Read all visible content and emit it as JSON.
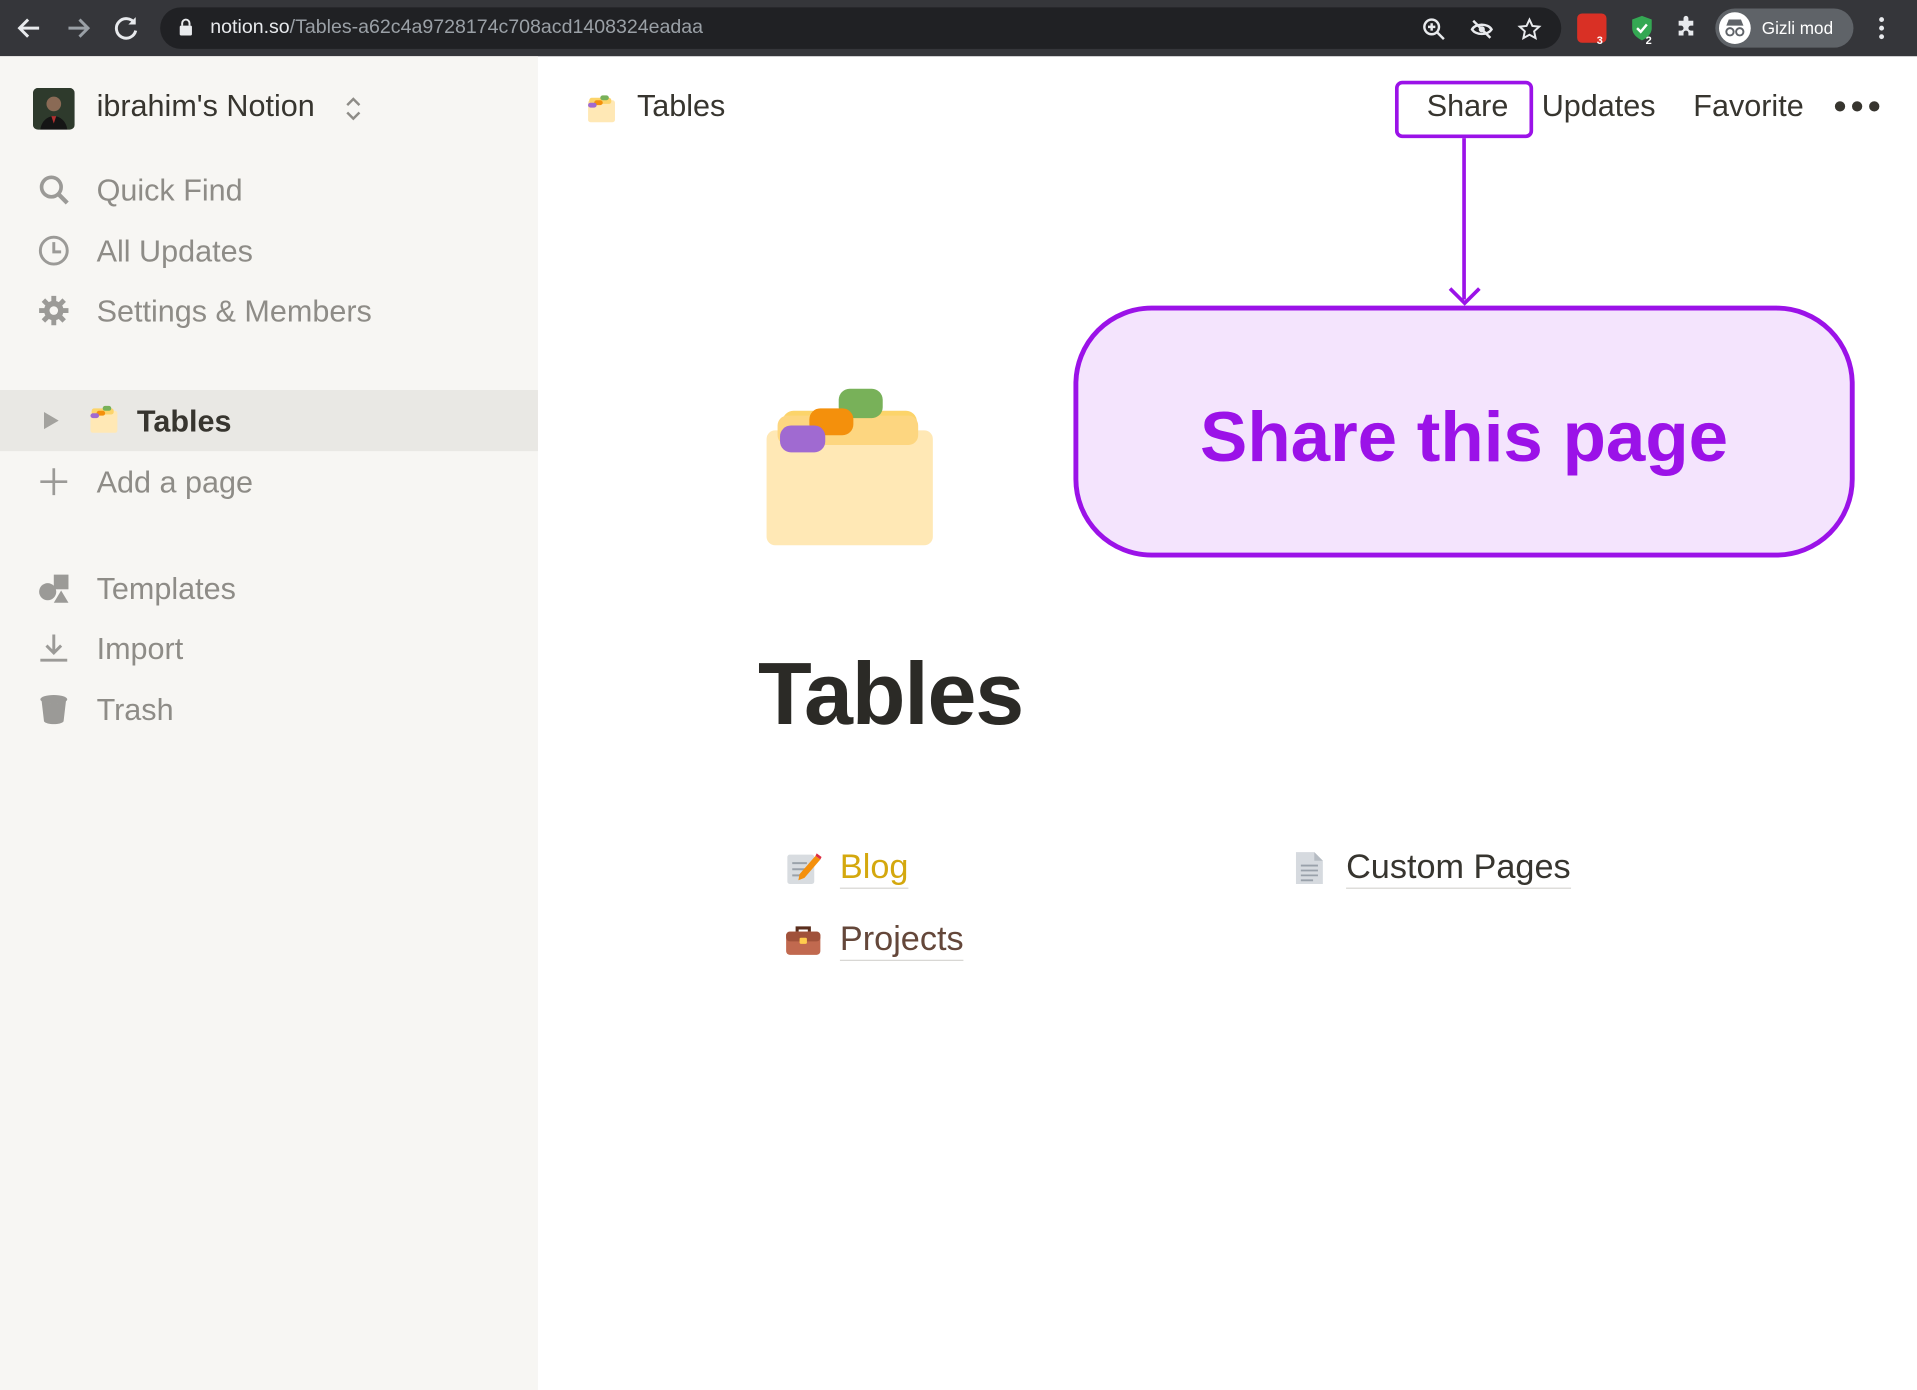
{
  "browser": {
    "url_host": "notion.so",
    "url_path": "/Tables-a62c4a9728174c708acd1408324eadaa",
    "ext1_badge": "3",
    "ext2_badge": "2",
    "incognito_label": "Gizli mod",
    "icons": [
      "back-icon",
      "forward-icon",
      "reload-icon",
      "lock-icon",
      "zoom-icon",
      "eye-off-icon",
      "star-icon",
      "puzzle-icon",
      "incognito-icon",
      "more-vert-icon"
    ]
  },
  "sidebar": {
    "workspace_name": "ibrahim's Notion",
    "items": [
      {
        "label": "Quick Find",
        "icon": "search-icon"
      },
      {
        "label": "All Updates",
        "icon": "clock-icon"
      },
      {
        "label": "Settings & Members",
        "icon": "gear-icon"
      }
    ],
    "pages": [
      {
        "label": "Tables",
        "icon": "card-index-icon",
        "active": true
      }
    ],
    "add_page_label": "Add a page",
    "bottom_items": [
      {
        "label": "Templates",
        "icon": "shapes-icon"
      },
      {
        "label": "Import",
        "icon": "download-icon"
      },
      {
        "label": "Trash",
        "icon": "trash-icon"
      }
    ]
  },
  "topbar": {
    "breadcrumb": "Tables",
    "share_label": "Share",
    "updates_label": "Updates",
    "favorite_label": "Favorite"
  },
  "callout": {
    "text": "Share this page",
    "accent": "#9b12e8",
    "fill": "#f4e4fd"
  },
  "page": {
    "title": "Tables",
    "subpages": [
      {
        "label": "Blog",
        "icon": "memo-icon",
        "color": "#d4a80e"
      },
      {
        "label": "Custom Pages",
        "icon": "page-icon",
        "color": "#37352f"
      },
      {
        "label": "Projects",
        "icon": "briefcase-icon",
        "color": "#64473a"
      }
    ]
  }
}
